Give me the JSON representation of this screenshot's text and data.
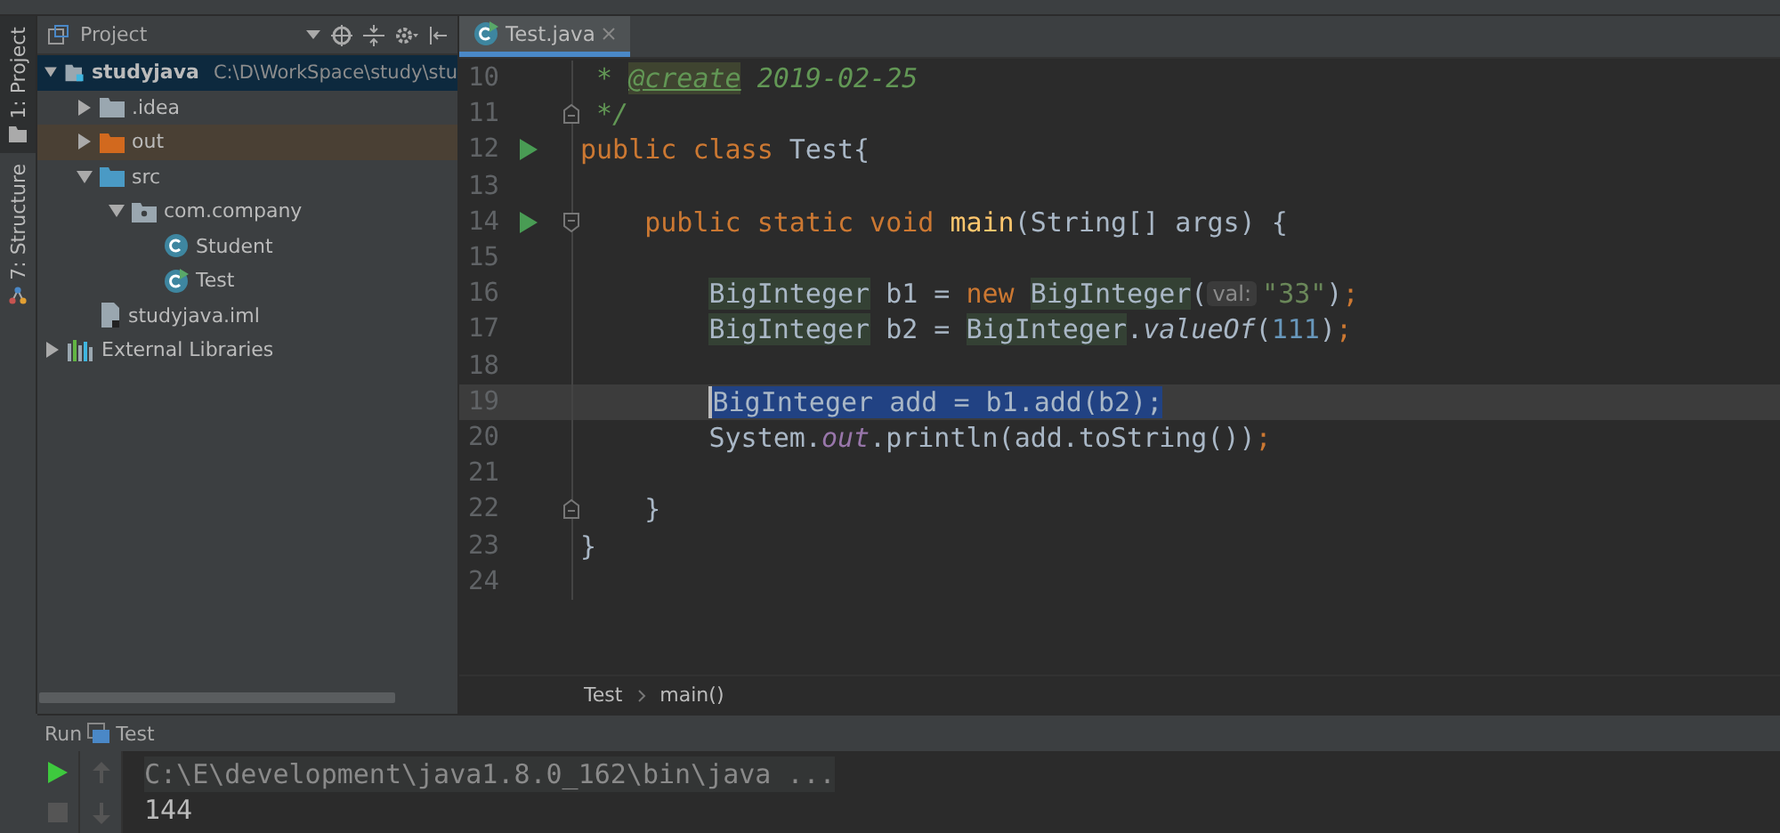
{
  "left_stripe": [
    {
      "label": "1: Project",
      "selected": true
    },
    {
      "label": "7: Structure",
      "selected": false
    }
  ],
  "project": {
    "title": "Project",
    "tree": [
      {
        "label": "studyjava",
        "path": "C:\\D\\WorkSpace\\study\\stu",
        "kind": "project",
        "expanded": true,
        "selected": true,
        "children": [
          {
            "label": ".idea",
            "kind": "folder",
            "expanded": false,
            "selected": false
          },
          {
            "label": "out",
            "kind": "excluded-folder",
            "expanded": false,
            "selected": false,
            "hovered": true
          },
          {
            "label": "src",
            "kind": "source-folder",
            "expanded": true,
            "selected": false,
            "children": [
              {
                "label": "com.company",
                "kind": "package",
                "expanded": true,
                "selected": false,
                "children": [
                  {
                    "label": "Student",
                    "kind": "class",
                    "selected": false
                  },
                  {
                    "label": "Test",
                    "kind": "runnable-class",
                    "selected": false
                  }
                ]
              }
            ]
          },
          {
            "label": "studyjava.iml",
            "kind": "module-file",
            "selected": false
          }
        ]
      },
      {
        "label": "External Libraries",
        "kind": "libraries",
        "expanded": false,
        "selected": false
      }
    ]
  },
  "editor": {
    "tabs": [
      {
        "label": "Test.java",
        "selected": true
      }
    ],
    "lines": [
      {
        "number": "10",
        "runnable": false,
        "fold_start": false,
        "fold_end": false,
        "tokens": [
          {
            "kind": "doc",
            "text": " * "
          },
          {
            "kind": "doc-tag",
            "text": "@create"
          },
          {
            "kind": "doc",
            "text": " 2019-02-25"
          }
        ]
      },
      {
        "number": "11",
        "runnable": false,
        "fold_start": false,
        "fold_end": true,
        "tokens": [
          {
            "kind": "doc",
            "text": " */"
          }
        ]
      },
      {
        "number": "12",
        "runnable": true,
        "fold_start": false,
        "fold_end": false,
        "tokens": [
          {
            "kind": "keyword",
            "text": "public class "
          },
          {
            "kind": "plain",
            "text": "Test{"
          }
        ],
        "children": [
          {
            "number": "13",
            "runnable": false,
            "fold_start": false,
            "fold_end": false
          },
          {
            "number": "14",
            "runnable": true,
            "fold_start": true,
            "fold_end": false,
            "tokens": [
              {
                "kind": "keyword",
                "text": "public static void "
              },
              {
                "kind": "method",
                "text": "main"
              },
              {
                "kind": "plain",
                "text": "(String[] args) {"
              }
            ],
            "children": [
              {
                "number": "15",
                "runnable": false,
                "fold_start": false,
                "fold_end": false
              },
              {
                "number": "16",
                "runnable": false,
                "fold_start": false,
                "fold_end": false,
                "tokens": [
                  {
                    "kind": "type",
                    "text": "BigInteger"
                  },
                  {
                    "kind": "plain",
                    "text": " b1 = "
                  },
                  {
                    "kind": "keyword",
                    "text": "new "
                  },
                  {
                    "kind": "type",
                    "text": "BigInteger"
                  },
                  {
                    "kind": "plain",
                    "text": "("
                  },
                  {
                    "kind": "hint",
                    "text": "val:"
                  },
                  {
                    "kind": "string",
                    "text": "\"33\""
                  },
                  {
                    "kind": "plain",
                    "text": ")"
                  },
                  {
                    "kind": "keyword",
                    "text": ";"
                  }
                ]
              },
              {
                "number": "17",
                "runnable": false,
                "fold_start": false,
                "fold_end": false,
                "tokens": [
                  {
                    "kind": "type",
                    "text": "BigInteger"
                  },
                  {
                    "kind": "plain",
                    "text": " b2 = "
                  },
                  {
                    "kind": "type",
                    "text": "BigInteger"
                  },
                  {
                    "kind": "plain",
                    "text": "."
                  },
                  {
                    "kind": "static",
                    "text": "valueOf"
                  },
                  {
                    "kind": "plain",
                    "text": "("
                  },
                  {
                    "kind": "number",
                    "text": "111"
                  },
                  {
                    "kind": "plain",
                    "text": ")"
                  },
                  {
                    "kind": "keyword",
                    "text": ";"
                  }
                ]
              },
              {
                "number": "18",
                "runnable": false,
                "fold_start": false,
                "fold_end": false
              },
              {
                "number": "19",
                "runnable": false,
                "fold_start": false,
                "fold_end": false,
                "current": true,
                "tokens": [
                  {
                    "kind": "selection",
                    "text": "BigInteger add = b1.add(b2);"
                  }
                ]
              },
              {
                "number": "20",
                "runnable": false,
                "fold_start": false,
                "fold_end": false,
                "tokens": [
                  {
                    "kind": "plain",
                    "text": "System."
                  },
                  {
                    "kind": "field",
                    "text": "out"
                  },
                  {
                    "kind": "plain",
                    "text": ".println(add.toString())"
                  },
                  {
                    "kind": "keyword",
                    "text": ";"
                  }
                ]
              },
              {
                "number": "21",
                "runnable": false,
                "fold_start": false,
                "fold_end": false
              }
            ]
          },
          {
            "number": "22",
            "runnable": false,
            "fold_start": false,
            "fold_end": true,
            "tokens": [
              {
                "kind": "plain",
                "text": "}"
              }
            ]
          }
        ]
      },
      {
        "number": "23",
        "runnable": false,
        "fold_start": false,
        "fold_end": false,
        "tokens": [
          {
            "kind": "plain",
            "text": "}"
          }
        ]
      },
      {
        "number": "24",
        "runnable": false,
        "fold_start": false,
        "fold_end": false
      }
    ],
    "breadcrumbs": [
      "Test",
      "main()"
    ]
  },
  "run": {
    "title": "Run",
    "config": "Test",
    "console": [
      {
        "kind": "command",
        "text": "C:\\E\\development\\java1.8.0_162\\bin\\java ..."
      },
      {
        "kind": "output",
        "text": "144"
      }
    ]
  }
}
